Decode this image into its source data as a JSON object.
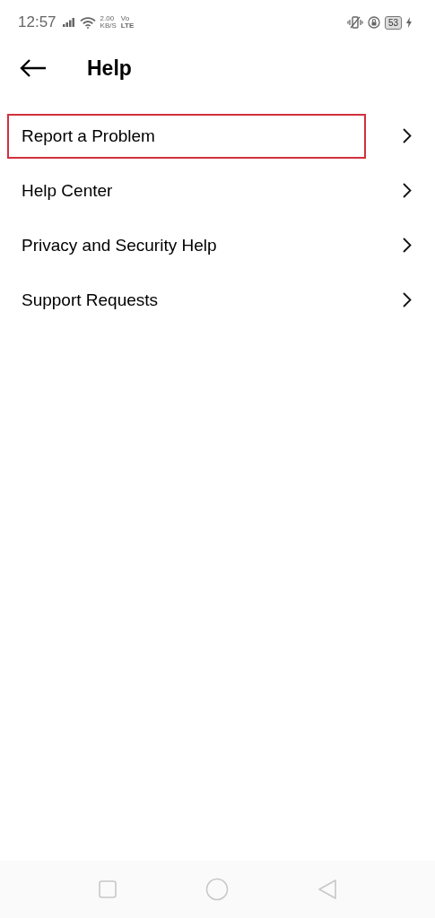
{
  "status_bar": {
    "time": "12:57",
    "speed_value": "2.00",
    "speed_unit": "KB/S",
    "volte_top": "Vo",
    "volte_bottom": "LTE",
    "battery": "53"
  },
  "header": {
    "title": "Help"
  },
  "items": [
    {
      "label": "Report a Problem",
      "highlighted": true
    },
    {
      "label": "Help Center",
      "highlighted": false
    },
    {
      "label": "Privacy and Security Help",
      "highlighted": false
    },
    {
      "label": "Support Requests",
      "highlighted": false
    }
  ]
}
